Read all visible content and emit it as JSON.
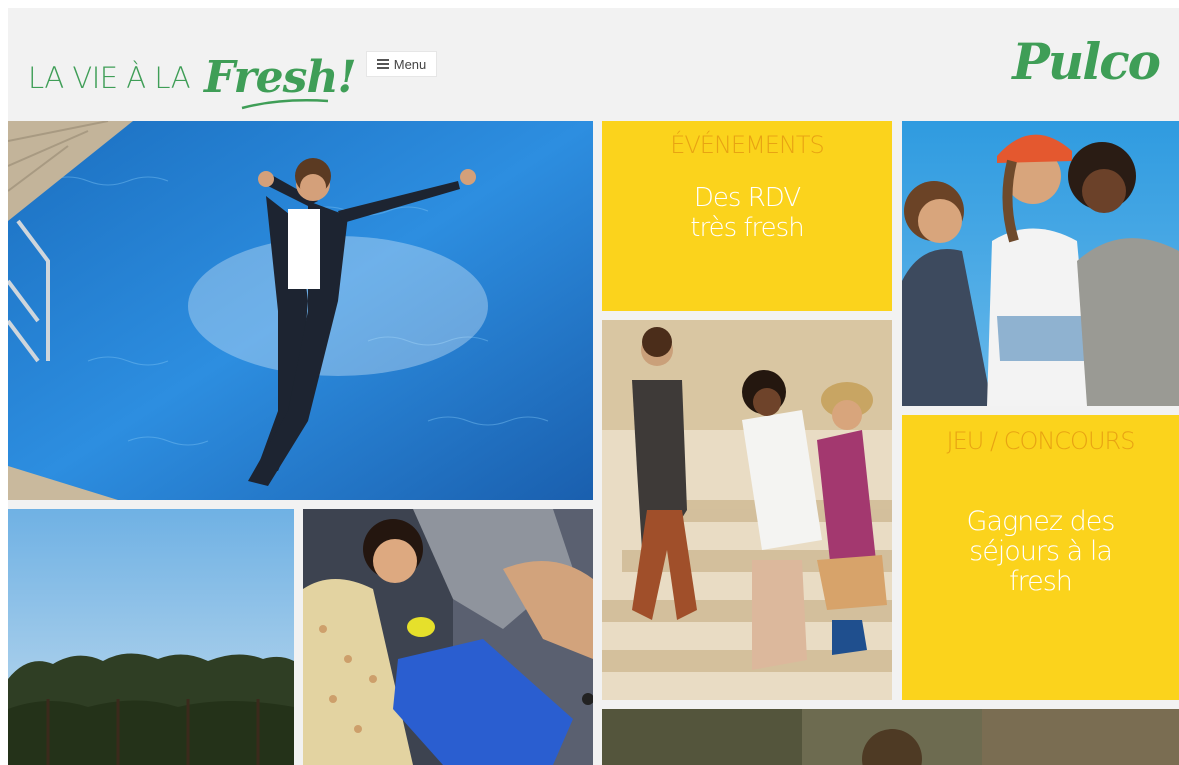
{
  "header": {
    "tagline_prefix": "LA VIE À LA",
    "tagline_script": "Fresh!",
    "menu_label": "Menu",
    "brand": "Pulco"
  },
  "tiles": {
    "events": {
      "kicker": "ÉVÉNEMENTS",
      "line1": "Des RDV",
      "line2": "très fresh"
    },
    "contest": {
      "kicker": "JEU / CONCOURS",
      "line1": "Gagnez des",
      "line2": "séjours à la",
      "line3": "fresh"
    }
  },
  "colors": {
    "brand_green": "#3f9e57",
    "tile_yellow": "#fbd31c",
    "kicker_orange": "#e8a313",
    "background": "#f2f2f2"
  },
  "icons": {
    "menu": "hamburger-icon"
  }
}
